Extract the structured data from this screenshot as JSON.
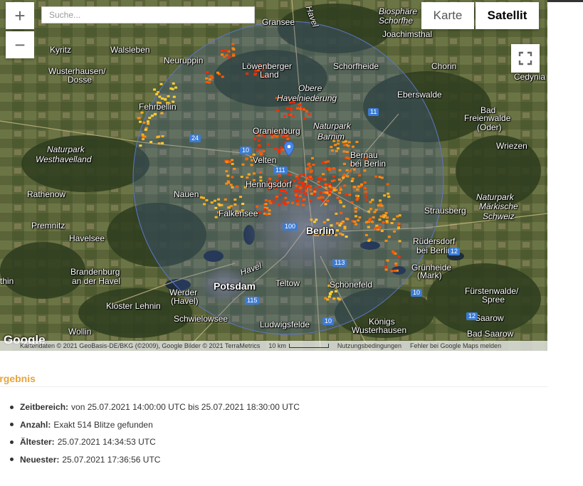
{
  "search": {
    "placeholder": "Suche..."
  },
  "controls": {
    "zoom_in": "+",
    "zoom_out": "−",
    "maptype_map": "Karte",
    "maptype_satellite": "Satellit"
  },
  "towns": [
    {
      "name": "Kyritz"
    },
    {
      "name": "Walsleben"
    },
    {
      "name": "Wusterhausen/"
    },
    {
      "name": "Dosse"
    },
    {
      "name": "Neuruppin"
    },
    {
      "name": "Gransee"
    },
    {
      "name": "Löwenberger"
    },
    {
      "name": "Land"
    },
    {
      "name": "Schorfheide"
    },
    {
      "name": "Joachimsthal"
    },
    {
      "name": "Chorin"
    },
    {
      "name": "Cedynia"
    },
    {
      "name": "Fehrbellin"
    },
    {
      "name": "Eberswalde"
    },
    {
      "name": "Bad"
    },
    {
      "name": "Freienwalde"
    },
    {
      "name": "(Oder)"
    },
    {
      "name": "Oranienburg"
    },
    {
      "name": "Wriezen"
    },
    {
      "name": "Bernau"
    },
    {
      "name": "bei Berlin"
    },
    {
      "name": "Velten"
    },
    {
      "name": "Rathenow"
    },
    {
      "name": "Nauen"
    },
    {
      "name": "Hennigsdorf"
    },
    {
      "name": "Falkensee"
    },
    {
      "name": "Strausberg"
    },
    {
      "name": "Premnitz"
    },
    {
      "name": "Havelsee"
    },
    {
      "name": "Berlin"
    },
    {
      "name": "Rüdersdorf"
    },
    {
      "name": "bei Berlin"
    },
    {
      "name": "Brandenburg"
    },
    {
      "name": "an der Havel"
    },
    {
      "name": "Grünheide"
    },
    {
      "name": "(Mark)"
    },
    {
      "name": "thin"
    },
    {
      "name": "Potsdam"
    },
    {
      "name": "Teltow"
    },
    {
      "name": "Schönefeld"
    },
    {
      "name": "Werder"
    },
    {
      "name": "(Havel)"
    },
    {
      "name": "Fürstenwalde/"
    },
    {
      "name": "Spree"
    },
    {
      "name": "Kloster Lehnin"
    },
    {
      "name": "Schwielowsee"
    },
    {
      "name": "Ludwigsfelde"
    },
    {
      "name": "Königs"
    },
    {
      "name": "Wusterhausen"
    },
    {
      "name": "Saarow"
    },
    {
      "name": "Wollin"
    },
    {
      "name": "Bad Saarow"
    },
    {
      "name": "Havel"
    },
    {
      "name": "Havel"
    }
  ],
  "parks": [
    {
      "name": "Biosphäre"
    },
    {
      "name": "Schorfhe"
    },
    {
      "name": "Obere"
    },
    {
      "name": "Havelniederung"
    },
    {
      "name": "Naturpark"
    },
    {
      "name": "Barnim"
    },
    {
      "name": "Naturpark"
    },
    {
      "name": "Westhavelland"
    },
    {
      "name": "Naturpark"
    },
    {
      "name": "Märkische"
    },
    {
      "name": "Schweiz"
    }
  ],
  "road_shields": [
    "11",
    "24",
    "10",
    "111",
    "100",
    "113",
    "115",
    "10",
    "10",
    "12",
    "12"
  ],
  "lightning_summary": {
    "count": 514,
    "colors": [
      "#ff2a00",
      "#ff5a00",
      "#ff8a10",
      "#ffb020",
      "#ffd030"
    ]
  },
  "attribution": {
    "logo": "Google",
    "data": "Kartendaten © 2021 GeoBasis-DE/BKG (©2009), Google Bilder © 2021 TerraMetrics",
    "scale": "10 km",
    "terms": "Nutzungsbedingungen",
    "report": "Fehler bei Google Maps melden"
  },
  "result": {
    "heading": "Ergebnis",
    "items": [
      {
        "label": "Zeitbereich:",
        "value": "von 25.07.2021 14:00:00 UTC bis 25.07.2021 18:30:00 UTC"
      },
      {
        "label": "Anzahl:",
        "value": "Exakt 514 Blitze gefunden"
      },
      {
        "label": "Ältester:",
        "value": "25.07.2021 14:34:53 UTC"
      },
      {
        "label": "Neuester:",
        "value": "25.07.2021 17:36:56 UTC"
      }
    ]
  },
  "colors": {
    "accent": "#e8a43a",
    "radius_circle": "#5a78c8",
    "marker": "#4a86e8"
  }
}
